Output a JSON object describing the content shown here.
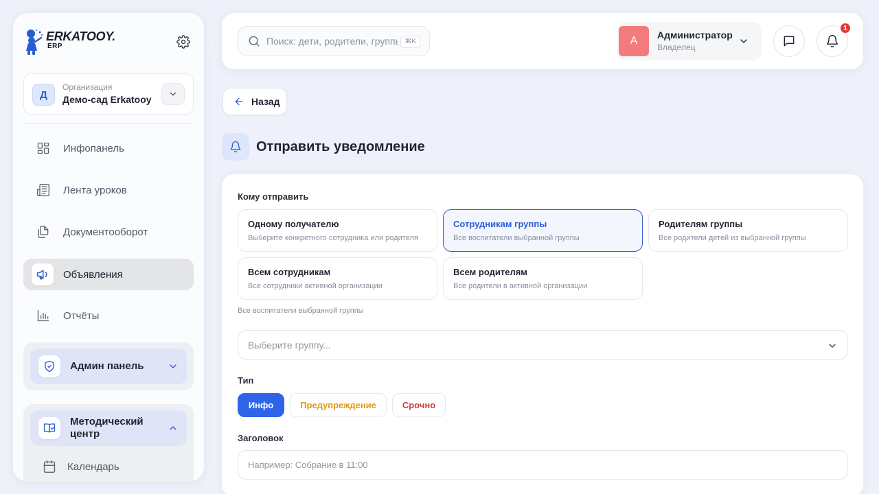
{
  "sidebar": {
    "logo_name": "ERKATOOY.",
    "logo_sub": "ERP",
    "org": {
      "label": "Организация",
      "name": "Демо-сад Erkatooy",
      "avatar_letter": "Д"
    },
    "nav": [
      {
        "label": "Инфопанель",
        "icon": "dashboard-icon"
      },
      {
        "label": "Лента уроков",
        "icon": "newspaper-icon"
      },
      {
        "label": "Документооборот",
        "icon": "documents-icon"
      },
      {
        "label": "Объявления",
        "icon": "megaphone-icon",
        "active": true
      },
      {
        "label": "Отчёты",
        "icon": "chart-icon"
      }
    ],
    "admin_group": {
      "label": "Админ панель",
      "icon": "shield-icon",
      "expanded": false
    },
    "method_group": {
      "label": "Методический центр",
      "icon": "book-icon",
      "expanded": true,
      "items": [
        {
          "label": "Календарь",
          "icon": "calendar-icon"
        }
      ]
    }
  },
  "header": {
    "search_placeholder": "Поиск: дети, родители, группы",
    "search_shortcut": "⌘K",
    "user": {
      "avatar_letter": "A",
      "name": "Администратор",
      "role": "Владелец"
    },
    "notifications_count": "1"
  },
  "page": {
    "back_label": "Назад",
    "title": "Отправить уведомление"
  },
  "form": {
    "recipient_label": "Кому отправить",
    "recipient_options": [
      {
        "title": "Одному получателю",
        "desc": "Выберите конкретного сотрудника или родителя"
      },
      {
        "title": "Сотрудникам группы",
        "desc": "Все воспитатели выбранной группы",
        "selected": true
      },
      {
        "title": "Родителям группы",
        "desc": "Все родители детей из выбранной группы"
      },
      {
        "title": "Всем сотрудникам",
        "desc": "Все сотрудники активной организации"
      },
      {
        "title": "Всем родителям",
        "desc": "Все родители в активной организации"
      }
    ],
    "recipient_hint": "Все воспитатели выбранной группы",
    "group_select_placeholder": "Выберите группу...",
    "type_label": "Тип",
    "types": {
      "info": "Инфо",
      "warning": "Предупреждение",
      "urgent": "Срочно"
    },
    "selected_type": "Инфо",
    "heading_label": "Заголовок",
    "heading_placeholder": "Например: Собрание в 11:00",
    "colors": {
      "accent": "#2d64e8",
      "warning": "#e39a12",
      "urgent": "#d63a3a"
    }
  }
}
